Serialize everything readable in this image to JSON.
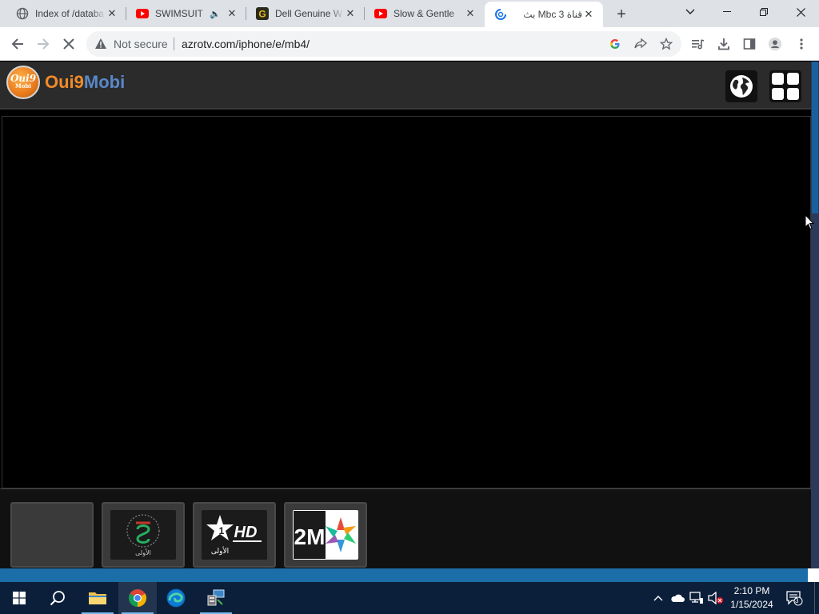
{
  "browser": {
    "tabs": [
      {
        "title": "Index of /databa",
        "icon": "globe-icon"
      },
      {
        "title": "SWIMSUIT",
        "icon": "youtube-icon",
        "audio": true
      },
      {
        "title": "Dell Genuine W",
        "icon": "g-icon"
      },
      {
        "title": "Slow & Gentle",
        "icon": "youtube-icon"
      },
      {
        "title": "قناة Mbc 3 بث",
        "icon": "loading-icon",
        "active": true
      }
    ],
    "new_tab": "+",
    "omnibox": {
      "security": "Not secure",
      "url": "azrotv.com/iphone/e/mb4/"
    }
  },
  "page": {
    "logo": {
      "badge": "Oui9",
      "badge_sub": "Mobi",
      "name_a": "Oui9",
      "name_b": "Mobi"
    },
    "channels": [
      {
        "name": "empty-channel"
      },
      {
        "name": "al-aoula-channel",
        "label": "الأولى"
      },
      {
        "name": "al-aoula-hd-channel",
        "label": "HD",
        "sub": "الأولى"
      },
      {
        "name": "2m-channel",
        "label": "2M"
      }
    ]
  },
  "taskbar": {
    "time": "2:10 PM",
    "date": "1/15/2024",
    "notifications": "3"
  },
  "colors": {
    "accent_orange": "#f08a2a",
    "accent_blue": "#5a87c8",
    "taskbar": "#0b1f3a",
    "page_bar": "#1c6ea8"
  }
}
